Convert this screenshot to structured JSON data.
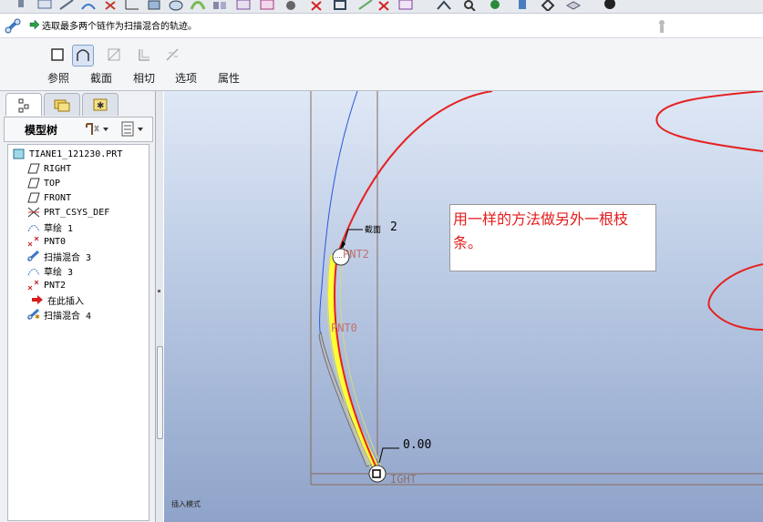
{
  "dashboard": {
    "prompt": "选取最多两个链作为扫描混合的轨迹。",
    "tabs": [
      "参照",
      "截面",
      "相切",
      "选项",
      "属性"
    ]
  },
  "model_tree": {
    "title": "模型树",
    "items": [
      {
        "label": "TIANE1_121230.PRT",
        "icon": "part-icon"
      },
      {
        "label": "RIGHT",
        "icon": "datum-plane-icon"
      },
      {
        "label": "TOP",
        "icon": "datum-plane-icon"
      },
      {
        "label": "FRONT",
        "icon": "datum-plane-icon"
      },
      {
        "label": "PRT_CSYS_DEF",
        "icon": "csys-icon"
      },
      {
        "label": "草绘 1",
        "icon": "sketch-icon"
      },
      {
        "label": "PNT0",
        "icon": "datum-point-icon"
      },
      {
        "label": "扫描混合 3",
        "icon": "swept-blend-icon"
      },
      {
        "label": "草绘 3",
        "icon": "sketch-icon"
      },
      {
        "label": "PNT2",
        "icon": "datum-point-icon"
      },
      {
        "label": "在此插入",
        "icon": "insert-here-arrow-icon"
      },
      {
        "label": "扫描混合 4",
        "icon": "swept-blend-active-icon"
      }
    ]
  },
  "graphics": {
    "callout": "用一样的方法做另外一根枝条。",
    "labels": {
      "section": "截面",
      "section_num": "2",
      "pnt2": "PNT2",
      "pnt0": "PNT0",
      "dim": "0.00",
      "right": "IGHT"
    },
    "status": "插入模式"
  },
  "colors": {
    "trajectory": "#e52222",
    "preview": "#ffff33",
    "datum_line": "#8a6a5a",
    "curve_blue": "#2a55dd"
  }
}
